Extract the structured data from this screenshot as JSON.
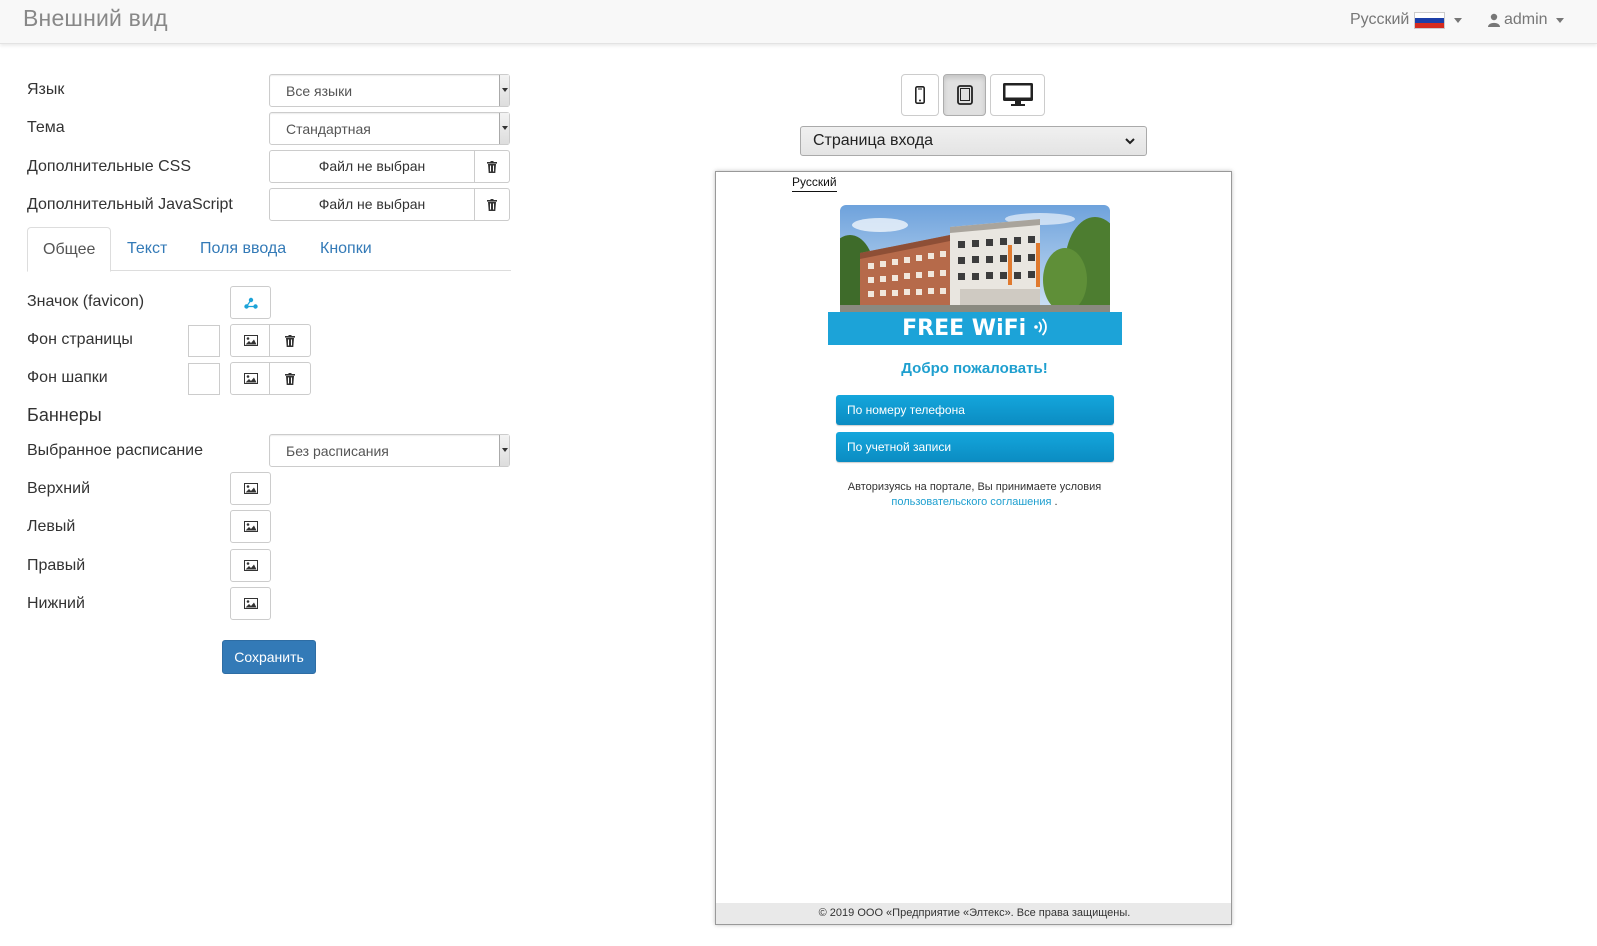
{
  "header": {
    "title": "Внешний вид",
    "language": "Русский",
    "user": "admin"
  },
  "form": {
    "language_label": "Язык",
    "language_value": "Все языки",
    "theme_label": "Тема",
    "theme_value": "Стандартная",
    "css_label": "Дополнительные CSS",
    "css_file": "Файл не выбран",
    "js_label": "Дополнительный JavaScript",
    "js_file": "Файл не выбран"
  },
  "tabs": [
    {
      "label": "Общее",
      "active": true
    },
    {
      "label": "Текст",
      "active": false
    },
    {
      "label": "Поля ввода",
      "active": false
    },
    {
      "label": "Кнопки",
      "active": false
    }
  ],
  "general": {
    "favicon_label": "Значок (favicon)",
    "page_bg_label": "Фон страницы",
    "header_bg_label": "Фон шапки",
    "banners_heading": "Баннеры",
    "schedule_label": "Выбранное расписание",
    "schedule_value": "Без расписания",
    "banner_top": "Верхний",
    "banner_left": "Левый",
    "banner_right": "Правый",
    "banner_bottom": "Нижний",
    "save_label": "Сохранить"
  },
  "preview": {
    "page_select": "Страница входа",
    "language": "Русский",
    "wifi_text": "FREE WiFi",
    "welcome": "Добро пожаловать!",
    "buttons": [
      "По номеру телефона",
      "По учетной записи"
    ],
    "terms_text": "Авторизуясь на портале, Вы принимаете условия",
    "terms_link": "пользовательского соглашения",
    "terms_end": " .",
    "footer": "© 2019 ООО «Предприятие «Элтекс». Все права защищены."
  },
  "colors": {
    "primary": "#337ab7",
    "portal_accent": "#1ca3d8"
  }
}
